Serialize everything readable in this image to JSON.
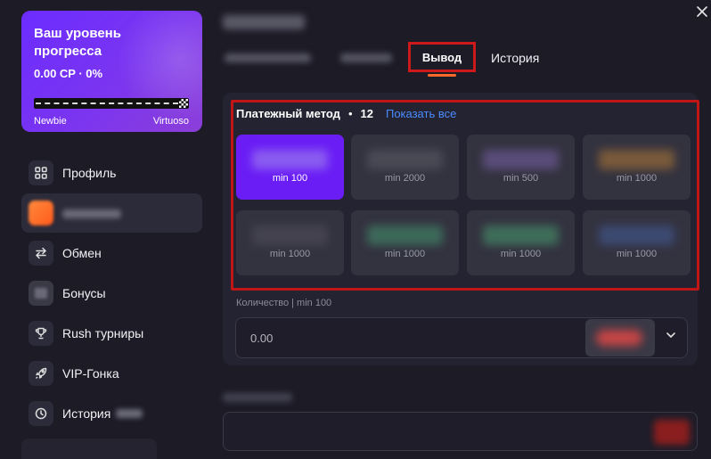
{
  "progress": {
    "title": "Ваш уровень прогресса",
    "value": "0.00 CP · 0%",
    "percent": 0,
    "level_from": "Newbie",
    "level_to": "Virtuoso"
  },
  "sidebar": {
    "items": [
      {
        "label": "Профиль",
        "icon": "grid-icon"
      },
      {
        "label": "",
        "icon": "wallet-icon",
        "active": true
      },
      {
        "label": "Обмен",
        "icon": "exchange-icon"
      },
      {
        "label": "Бонусы",
        "icon": "gift-icon"
      },
      {
        "label": "Rush турниры",
        "icon": "trophy-icon"
      },
      {
        "label": "VIP-Гонка",
        "icon": "rocket-icon"
      },
      {
        "label": "История",
        "icon": "clock-icon"
      }
    ]
  },
  "tabs": {
    "withdraw": "Вывод",
    "history": "История"
  },
  "payment": {
    "title": "Платежный метод",
    "separator": "•",
    "count": "12",
    "show_all": "Показать все",
    "methods": [
      {
        "min": "min 100",
        "color": "#8a5cf0",
        "active": true
      },
      {
        "min": "min 2000",
        "color": "#4a4a56"
      },
      {
        "min": "min 500",
        "color": "#5a4d7a"
      },
      {
        "min": "min 1000",
        "color": "#7a5a3a"
      },
      {
        "min": "min 1000",
        "color": "#44434f"
      },
      {
        "min": "min 1000",
        "color": "#3d6a5a"
      },
      {
        "min": "min 1000",
        "color": "#3f6e5a"
      },
      {
        "min": "min 1000",
        "color": "#3c4a72"
      }
    ]
  },
  "quantity": {
    "label": "Количество | min 100",
    "placeholder": "0.00"
  },
  "colors": {
    "accent": "#6a1df5",
    "highlight_border": "#cc1a1a",
    "link": "#4a8cff",
    "tab_underline": "#ff6a2b"
  }
}
